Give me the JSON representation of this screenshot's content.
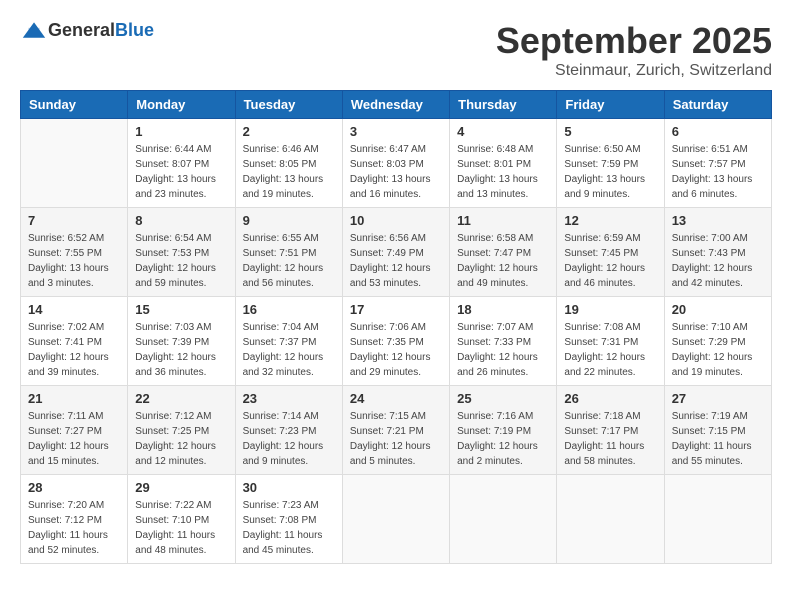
{
  "header": {
    "logo_general": "General",
    "logo_blue": "Blue",
    "month": "September 2025",
    "location": "Steinmaur, Zurich, Switzerland"
  },
  "weekdays": [
    "Sunday",
    "Monday",
    "Tuesday",
    "Wednesday",
    "Thursday",
    "Friday",
    "Saturday"
  ],
  "weeks": [
    [
      {
        "day": "",
        "info": ""
      },
      {
        "day": "1",
        "info": "Sunrise: 6:44 AM\nSunset: 8:07 PM\nDaylight: 13 hours\nand 23 minutes."
      },
      {
        "day": "2",
        "info": "Sunrise: 6:46 AM\nSunset: 8:05 PM\nDaylight: 13 hours\nand 19 minutes."
      },
      {
        "day": "3",
        "info": "Sunrise: 6:47 AM\nSunset: 8:03 PM\nDaylight: 13 hours\nand 16 minutes."
      },
      {
        "day": "4",
        "info": "Sunrise: 6:48 AM\nSunset: 8:01 PM\nDaylight: 13 hours\nand 13 minutes."
      },
      {
        "day": "5",
        "info": "Sunrise: 6:50 AM\nSunset: 7:59 PM\nDaylight: 13 hours\nand 9 minutes."
      },
      {
        "day": "6",
        "info": "Sunrise: 6:51 AM\nSunset: 7:57 PM\nDaylight: 13 hours\nand 6 minutes."
      }
    ],
    [
      {
        "day": "7",
        "info": "Sunrise: 6:52 AM\nSunset: 7:55 PM\nDaylight: 13 hours\nand 3 minutes."
      },
      {
        "day": "8",
        "info": "Sunrise: 6:54 AM\nSunset: 7:53 PM\nDaylight: 12 hours\nand 59 minutes."
      },
      {
        "day": "9",
        "info": "Sunrise: 6:55 AM\nSunset: 7:51 PM\nDaylight: 12 hours\nand 56 minutes."
      },
      {
        "day": "10",
        "info": "Sunrise: 6:56 AM\nSunset: 7:49 PM\nDaylight: 12 hours\nand 53 minutes."
      },
      {
        "day": "11",
        "info": "Sunrise: 6:58 AM\nSunset: 7:47 PM\nDaylight: 12 hours\nand 49 minutes."
      },
      {
        "day": "12",
        "info": "Sunrise: 6:59 AM\nSunset: 7:45 PM\nDaylight: 12 hours\nand 46 minutes."
      },
      {
        "day": "13",
        "info": "Sunrise: 7:00 AM\nSunset: 7:43 PM\nDaylight: 12 hours\nand 42 minutes."
      }
    ],
    [
      {
        "day": "14",
        "info": "Sunrise: 7:02 AM\nSunset: 7:41 PM\nDaylight: 12 hours\nand 39 minutes."
      },
      {
        "day": "15",
        "info": "Sunrise: 7:03 AM\nSunset: 7:39 PM\nDaylight: 12 hours\nand 36 minutes."
      },
      {
        "day": "16",
        "info": "Sunrise: 7:04 AM\nSunset: 7:37 PM\nDaylight: 12 hours\nand 32 minutes."
      },
      {
        "day": "17",
        "info": "Sunrise: 7:06 AM\nSunset: 7:35 PM\nDaylight: 12 hours\nand 29 minutes."
      },
      {
        "day": "18",
        "info": "Sunrise: 7:07 AM\nSunset: 7:33 PM\nDaylight: 12 hours\nand 26 minutes."
      },
      {
        "day": "19",
        "info": "Sunrise: 7:08 AM\nSunset: 7:31 PM\nDaylight: 12 hours\nand 22 minutes."
      },
      {
        "day": "20",
        "info": "Sunrise: 7:10 AM\nSunset: 7:29 PM\nDaylight: 12 hours\nand 19 minutes."
      }
    ],
    [
      {
        "day": "21",
        "info": "Sunrise: 7:11 AM\nSunset: 7:27 PM\nDaylight: 12 hours\nand 15 minutes."
      },
      {
        "day": "22",
        "info": "Sunrise: 7:12 AM\nSunset: 7:25 PM\nDaylight: 12 hours\nand 12 minutes."
      },
      {
        "day": "23",
        "info": "Sunrise: 7:14 AM\nSunset: 7:23 PM\nDaylight: 12 hours\nand 9 minutes."
      },
      {
        "day": "24",
        "info": "Sunrise: 7:15 AM\nSunset: 7:21 PM\nDaylight: 12 hours\nand 5 minutes."
      },
      {
        "day": "25",
        "info": "Sunrise: 7:16 AM\nSunset: 7:19 PM\nDaylight: 12 hours\nand 2 minutes."
      },
      {
        "day": "26",
        "info": "Sunrise: 7:18 AM\nSunset: 7:17 PM\nDaylight: 11 hours\nand 58 minutes."
      },
      {
        "day": "27",
        "info": "Sunrise: 7:19 AM\nSunset: 7:15 PM\nDaylight: 11 hours\nand 55 minutes."
      }
    ],
    [
      {
        "day": "28",
        "info": "Sunrise: 7:20 AM\nSunset: 7:12 PM\nDaylight: 11 hours\nand 52 minutes."
      },
      {
        "day": "29",
        "info": "Sunrise: 7:22 AM\nSunset: 7:10 PM\nDaylight: 11 hours\nand 48 minutes."
      },
      {
        "day": "30",
        "info": "Sunrise: 7:23 AM\nSunset: 7:08 PM\nDaylight: 11 hours\nand 45 minutes."
      },
      {
        "day": "",
        "info": ""
      },
      {
        "day": "",
        "info": ""
      },
      {
        "day": "",
        "info": ""
      },
      {
        "day": "",
        "info": ""
      }
    ]
  ]
}
